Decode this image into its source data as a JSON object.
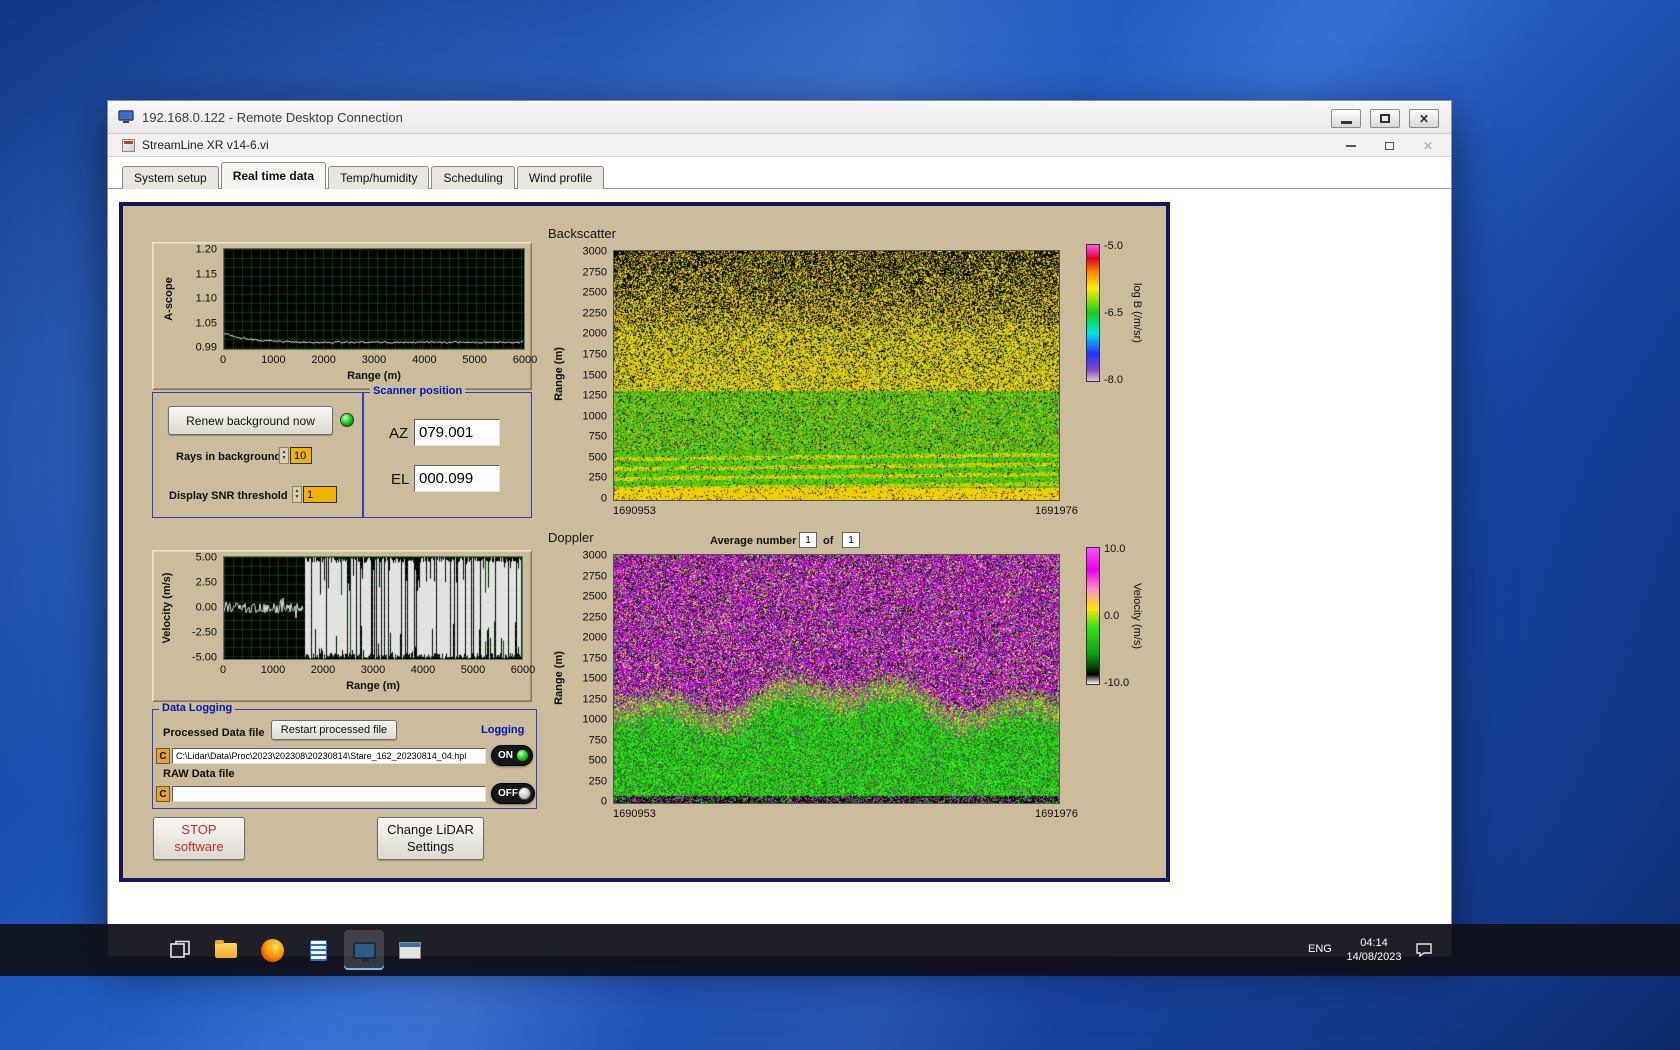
{
  "rdp": {
    "title": "192.168.0.122 - Remote Desktop Connection"
  },
  "app": {
    "title": "StreamLine XR v14-6.vi",
    "tabs": [
      "System setup",
      "Real time data",
      "Temp/humidity",
      "Scheduling",
      "Wind profile"
    ],
    "active_tab": "Real time data"
  },
  "ascope": {
    "ylabel": "A-scope",
    "xlabel": "Range (m)",
    "yticks": [
      "1.20",
      "1.15",
      "1.10",
      "1.05",
      "0.99"
    ],
    "xticks": [
      "0",
      "1000",
      "2000",
      "3000",
      "4000",
      "5000",
      "6000"
    ]
  },
  "controls": {
    "renew_button": "Renew background now",
    "rays_label": "Rays in background",
    "rays_value": "10",
    "snr_label": "Display SNR threshold",
    "snr_value": "1"
  },
  "scanner": {
    "title": "Scanner position",
    "az_label": "AZ",
    "az_value": "079.001",
    "el_label": "EL",
    "el_value": "000.099"
  },
  "backscatter": {
    "title": "Backscatter",
    "ylabel": "Range (m)",
    "yticks": [
      "3000",
      "2750",
      "2500",
      "2250",
      "2000",
      "1750",
      "1500",
      "1250",
      "1000",
      "750",
      "500",
      "250",
      "0"
    ],
    "x_left": "1690953",
    "x_right": "1691976",
    "colorbar": {
      "ticks": [
        "-5.0",
        "-6.5",
        "-8.0"
      ],
      "label": "log B (/m/sr)"
    }
  },
  "doppler": {
    "title": "Doppler",
    "avg_label": "Average number",
    "avg_value": "1",
    "of_label": "of",
    "of_count": "1",
    "ylabel": "Range (m)",
    "yticks": [
      "3000",
      "2750",
      "2500",
      "2250",
      "2000",
      "1750",
      "1500",
      "1250",
      "1000",
      "750",
      "500",
      "250",
      "0"
    ],
    "x_left": "1690953",
    "x_right": "1691976",
    "colorbar": {
      "ticks": [
        "10.0",
        "0.0",
        "-10.0"
      ],
      "label": "Velocity (m/s)"
    }
  },
  "velocity": {
    "ylabel": "Velocity (m/s)",
    "xlabel": "Range (m)",
    "yticks": [
      "5.00",
      "2.50",
      "0.00",
      "-2.50",
      "-5.00"
    ],
    "xticks": [
      "0",
      "1000",
      "2000",
      "3000",
      "4000",
      "5000",
      "6000"
    ]
  },
  "logging": {
    "title": "Data Logging",
    "processed_label": "Processed Data file",
    "restart_button": "Restart processed file",
    "logging_label": "Logging",
    "processed_drive": "C",
    "processed_path": "C:\\Lidar\\Data\\Proc\\2023\\202308\\20230814\\Stare_162_20230814_04.hpl",
    "on_label": "ON",
    "raw_label": "RAW Data file",
    "raw_drive": "C",
    "raw_path": "",
    "off_label": "OFF"
  },
  "actions": {
    "stop_line1": "STOP",
    "stop_line2": "software",
    "settings_line1": "Change LiDAR",
    "settings_line2": "Settings"
  },
  "taskbar": {
    "lang": "ENG",
    "time": "04:14",
    "date": "14/08/2023"
  }
}
